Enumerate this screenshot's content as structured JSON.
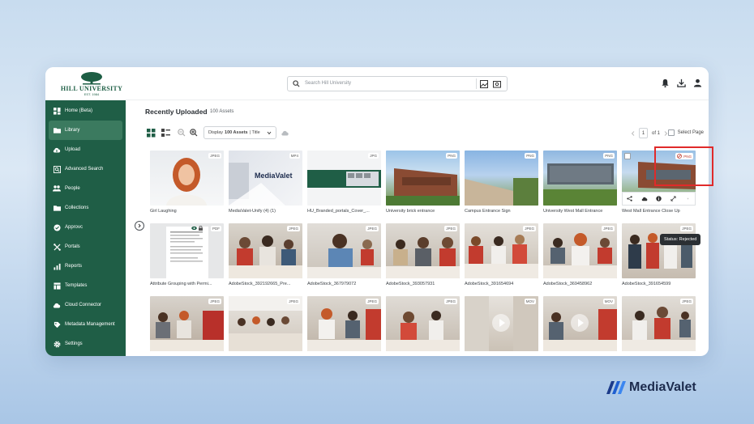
{
  "header": {
    "logo_name": "HILL UNIVERSITY",
    "logo_est": "EST. 1984",
    "search_placeholder": "Search Hill University"
  },
  "sidebar": {
    "items": [
      {
        "label": "Home (Beta)",
        "icon": "home-grid-icon"
      },
      {
        "label": "Library",
        "icon": "folder-icon"
      },
      {
        "label": "Upload",
        "icon": "cloud-upload-icon"
      },
      {
        "label": "Advanced Search",
        "icon": "advanced-search-icon"
      },
      {
        "label": "People",
        "icon": "people-icon"
      },
      {
        "label": "Collections",
        "icon": "collections-icon"
      },
      {
        "label": "Approvc",
        "icon": "approval-icon"
      },
      {
        "label": "Portals",
        "icon": "portals-icon"
      },
      {
        "label": "Reports",
        "icon": "reports-icon"
      },
      {
        "label": "Templates",
        "icon": "templates-icon"
      },
      {
        "label": "Cloud Connector",
        "icon": "cloud-icon"
      },
      {
        "label": "Metadata Management",
        "icon": "metadata-icon"
      },
      {
        "label": "Settings",
        "icon": "gear-icon"
      }
    ]
  },
  "content": {
    "title": "Recently Uploaded",
    "count": "100 Assets",
    "display_prefix": "Display",
    "display_value": "100 Assets",
    "display_suffix": "| Title",
    "page_current": "1",
    "page_of": "of 1",
    "select_page": "Select Page"
  },
  "assets": [
    {
      "label": "Girl Laughing",
      "type": "JPEG"
    },
    {
      "label": "MediaValet-Unify (4) (1)",
      "type": "MP4"
    },
    {
      "label": "HU_Branded_portals_Cover_...",
      "type": "JPG"
    },
    {
      "label": "University brick entrance",
      "type": "PNG"
    },
    {
      "label": "Campus Entrance Sign",
      "type": "PNG"
    },
    {
      "label": "University West Mall Entrance",
      "type": "PNG"
    },
    {
      "label": "West Mall Entrance Close Up",
      "type": "PNG"
    },
    {
      "label": "Attribute Grouping with Permi...",
      "type": "PDF"
    },
    {
      "label": "AdobeStock_392192665_Pre...",
      "type": "JPEG"
    },
    {
      "label": "AdobeStock_367979072",
      "type": "JPEG"
    },
    {
      "label": "AdobeStock_393057931",
      "type": "JPEG"
    },
    {
      "label": "AdobeStock_391654694",
      "type": "JPEG"
    },
    {
      "label": "AdobeStock_369458962",
      "type": "JPEG"
    },
    {
      "label": "AdobeStock_391654599",
      "type": "JPEG"
    },
    {
      "label": "",
      "type": "JPEG"
    },
    {
      "label": "",
      "type": "JPEG"
    },
    {
      "label": "",
      "type": "JPEG"
    },
    {
      "label": "",
      "type": "JPEG"
    },
    {
      "label": "",
      "type": "MOV"
    },
    {
      "label": "",
      "type": "MOV"
    },
    {
      "label": "",
      "type": "JPEG"
    }
  ],
  "hover": {
    "tooltip": "Status: Rejected",
    "mediavalet_text": "MediaValet"
  },
  "brand": "MediaValet",
  "colors": {
    "sidebar": "#1f5e46",
    "sidebar_active": "#3b7a5f",
    "highlight": "#e02a2a",
    "rejected": "#c0392b"
  }
}
